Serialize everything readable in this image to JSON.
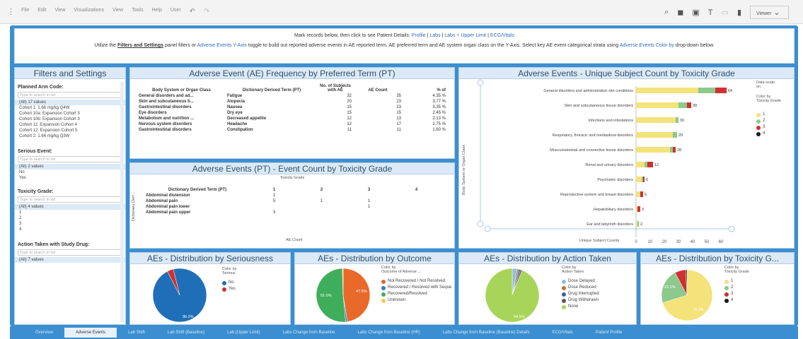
{
  "toolbar": {
    "menu": [
      "File",
      "Edit",
      "View",
      "Visualizations",
      "View",
      "Tools",
      "Help",
      "User"
    ],
    "viewer_label": "Viewer"
  },
  "notice": {
    "line1_text": "Mark records below, then click to see Patient Details:",
    "line1_links": [
      "Profile",
      "Labs",
      "Labs + Upper Limit",
      "ECG/Vitals"
    ],
    "line2_a": "Utilize the",
    "line2_b": "Filters and Settings",
    "line2_c": "panel filters or",
    "line2_d": "Adverse Events Y-Axis",
    "line2_e": "toggle to build out reported adverse events in AE reported term, AE preferred term and AE system organ class on the Y-Axis. Select key AE event categorical strata using",
    "line2_f": "Adverse Events Color by",
    "line2_g": "drop-down below."
  },
  "filters": {
    "title": "Filters and Settings",
    "planned_arm_label": "Planned Arm Code:",
    "search_placeholder": "Type to search in list",
    "planned_arm_items": [
      "(All) 17 values",
      "Cohort 1: 1.66 mg/kg Q4W",
      "Cohort 10a: Expansion Cohort 3",
      "Cohort 10b: Expansion Cohort 3",
      "Cohort 11: Expansion Cohort 4",
      "Cohort 12: Expansion Cohort 5",
      "Cohort 2: 1.66 mg/kg Q3W"
    ],
    "serious_label": "Serious Event:",
    "serious_items": [
      "(All) 2 values",
      "No",
      "Yes"
    ],
    "toxicity_label": "Toxicity Grade:",
    "toxicity_items": [
      "(All) 4 values",
      "1",
      "2",
      "3",
      "4"
    ],
    "action_label": "Action Taken with Study Drug:",
    "action_items": [
      "(All) 7 values"
    ]
  },
  "freq": {
    "title": "Adverse Event (AE) Frequency by Preferred Term (PT)",
    "headers": [
      "Body System or Organ Class",
      "Dictionary Derived Term (PT)",
      "No. of Subjects with AE",
      "AE Count",
      "% of"
    ],
    "rows": [
      [
        "General disorders and ad...",
        "Fatigue",
        "32",
        "35",
        "4.35 %"
      ],
      [
        "Skin and subcutaneous ti...",
        "Alopecia",
        "20",
        "23",
        "3.77 %"
      ],
      [
        "Gastrointestinal disorders",
        "Nausea",
        "15",
        "23",
        "3.35 %"
      ],
      [
        "Eye disorders",
        "Dry eye",
        "15",
        "15",
        "2.45 %"
      ],
      [
        "Metabolism and nutrition ...",
        "Decreased appetite",
        "12",
        "13",
        "2.13 %"
      ],
      [
        "Nervous system disorders",
        "Headache",
        "12",
        "17",
        "2.75 %"
      ],
      [
        "Gastrointestinal disorders",
        "Constipation",
        "11",
        "11",
        "1.60 %"
      ]
    ]
  },
  "event_count": {
    "title": "Adverse Events (PT) - Event Count by Toxicity Grade",
    "col_title": "Toxicity Grade",
    "row_header": "Dictionary Derived Term (PT)",
    "grades": [
      "1",
      "2",
      "3",
      "4"
    ],
    "rows": [
      [
        "Abdominal distension",
        "1",
        "",
        "",
        ""
      ],
      [
        "Abdominal pain",
        "5",
        "1",
        "1",
        ""
      ],
      [
        "Abdominal pain lower",
        "",
        "",
        "1",
        ""
      ],
      [
        "Abdominal pain upper",
        "3",
        "",
        "",
        ""
      ]
    ],
    "y_axis": "Dictionary Derr...",
    "x_label": "AE Count"
  },
  "unique": {
    "title": "Adverse Events - Unique Subject Count by Toxicity Grade",
    "y_axis_label": "Body System or Organ Class",
    "x_axis_label": "Unique Subject Counts",
    "x_ticks": [
      "0",
      "10",
      "20",
      "30",
      "40",
      "50",
      "60"
    ],
    "color_labels": [
      "Data scale:",
      "on",
      "Color by",
      "Toxicity Grade"
    ],
    "legend": [
      "1",
      "2",
      "3",
      "4"
    ],
    "colors": [
      "#f4e27a",
      "#8cc98c",
      "#d03030",
      "#1a1a1a"
    ]
  },
  "chart_data": [
    {
      "type": "bar",
      "title": "Adverse Events - Unique Subject Count by Toxicity Grade",
      "ylabel": "Body System or Organ Class",
      "xlabel": "Unique Subject Counts",
      "xlim": [
        0,
        60
      ],
      "categories": [
        "General disorders and administration site conditions",
        "Skin and subcutaneous tissue disorders",
        "Infections and infestations",
        "Respiratory, thoracic and mediastinal disorders",
        "Musculoskeletal and connective tissue disorders",
        "Renal and urinary disorders",
        "Psychiatric disorders",
        "Reproductive system and breast disorders",
        "Hepatobiliary disorders",
        "Ear and labyrinth disorders"
      ],
      "series": [
        {
          "name": "1",
          "values": [
            44,
            30,
            28,
            26,
            24,
            6,
            4,
            3,
            1,
            1
          ]
        },
        {
          "name": "2",
          "values": [
            12,
            6,
            2,
            3,
            2,
            2,
            1,
            0,
            0,
            1
          ]
        },
        {
          "name": "3",
          "values": [
            8,
            3,
            0,
            0,
            2,
            4,
            1,
            2,
            2,
            0
          ]
        },
        {
          "name": "4",
          "values": [
            0,
            0,
            0,
            0,
            0,
            0,
            0,
            0,
            0,
            0
          ]
        }
      ],
      "totals": [
        64,
        39,
        30,
        29,
        28,
        12,
        6,
        5,
        3,
        2
      ]
    },
    {
      "type": "pie",
      "title": "AEs - Distribution by Seriousness",
      "labels": [
        "No",
        "Yes"
      ],
      "values": [
        96.2,
        3.8
      ],
      "colors": [
        "#1f6fb8",
        "#d03030"
      ],
      "data_labels": [
        "96.2%"
      ]
    },
    {
      "type": "pie",
      "title": "AEs - Distribution by Outcome",
      "labels": [
        "Not Recovered / Not Resolved",
        "Recovered / Resolved with Sequelae",
        "Recovered/Resolved",
        "Unknown"
      ],
      "values": [
        47.5,
        1.0,
        51.0,
        0.5
      ],
      "colors": [
        "#e8692a",
        "#3a78c8",
        "#3fae5a",
        "#f0c85a"
      ],
      "data_labels": [
        "47.5%",
        "51.0%"
      ]
    },
    {
      "type": "pie",
      "title": "AEs - Distribution by Action Taken",
      "labels": [
        "Dose Delayed",
        "Dose Reduced",
        "Drug Interrupted",
        "Drug Withdrawn",
        "None"
      ],
      "values": [
        3,
        1,
        1,
        1,
        94
      ],
      "colors": [
        "#8fbfe0",
        "#c7742a",
        "#3a5fa8",
        "#5a5a5a",
        "#a8d45a"
      ],
      "data_labels": [
        "94.5%"
      ]
    },
    {
      "type": "pie",
      "title": "AEs - Distribution by Toxicity Grade",
      "labels": [
        "1",
        "2",
        "3",
        "4"
      ],
      "values": [
        70.2,
        22.1,
        6.9,
        0.8
      ],
      "colors": [
        "#f4e27a",
        "#8cc98c",
        "#d03030",
        "#1a1a1a"
      ],
      "data_labels": [
        "22.1%",
        "70.2%"
      ]
    }
  ],
  "pies": [
    {
      "title": "AEs - Distribution by Seriousness",
      "color_by": [
        "Color by",
        "Serious"
      ]
    },
    {
      "title": "AEs - Distribution by Outcome",
      "color_by": [
        "Color by",
        "Outcome of Adverse ..."
      ]
    },
    {
      "title": "AEs - Distribution by Action Taken",
      "color_by": [
        "Color by",
        "Action Taken"
      ]
    },
    {
      "title": "AEs - Distribution by Toxicity G...",
      "color_by": [
        "Color by",
        "Toxicity Grade"
      ]
    }
  ],
  "tabs": [
    "Overview",
    "Adverse Events",
    "Lab Shift",
    "Lab Shift (Baseline)",
    "Lab (Upper Limit)",
    "Labs Change from Baseline",
    "Labs Change from Baseline (HR)",
    "Labs Change from Baseline (Baseline) Details",
    "ECG/Vitals",
    "Patient Profile"
  ]
}
